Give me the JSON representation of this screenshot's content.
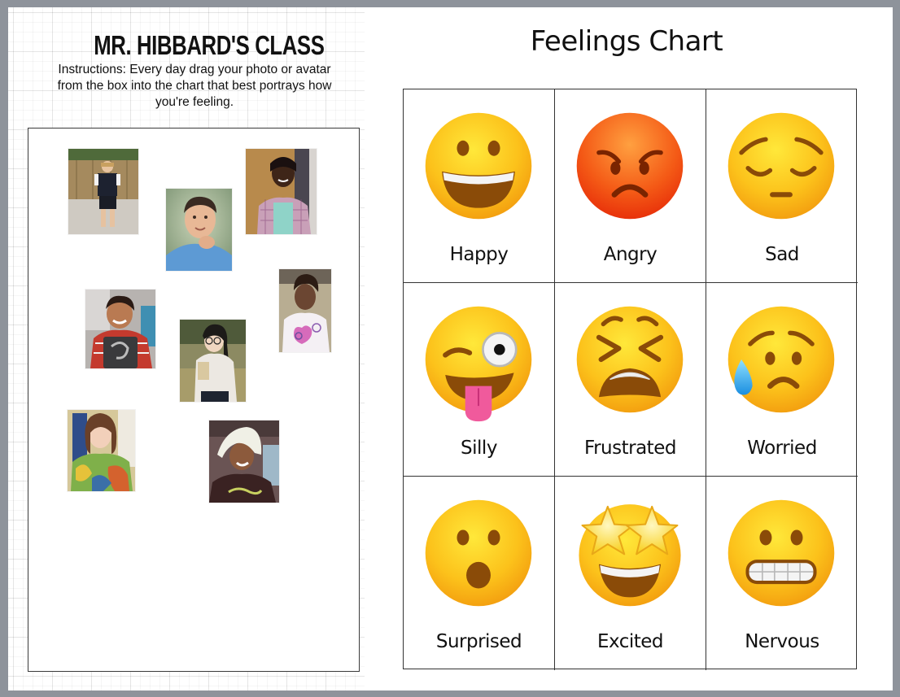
{
  "left_panel": {
    "class_title": "MR. HIBBARD'S CLASS",
    "instructions": "Instructions: Every day drag your photo or avatar from the box into the chart that best portrays how you're feeling.",
    "photo_box": {
      "photos": [
        {
          "name": "student-photo-1",
          "description": "boy in school uniform in front of wooden fence"
        },
        {
          "name": "student-photo-2",
          "description": "smiling boy with hand on chin, blue shirt"
        },
        {
          "name": "student-photo-3",
          "description": "smiling girl in plaid shirt"
        },
        {
          "name": "student-photo-4",
          "description": "smiling boy holding chalkboard"
        },
        {
          "name": "student-photo-5",
          "description": "girl with glasses holding book in field"
        },
        {
          "name": "student-photo-6",
          "description": "girl in pink heart t-shirt"
        },
        {
          "name": "student-photo-7",
          "description": "girl in colorful floral dress"
        },
        {
          "name": "student-photo-8",
          "description": "boy with book on head"
        }
      ]
    }
  },
  "chart": {
    "title": "Feelings Chart",
    "cells": [
      {
        "label": "Happy",
        "icon": "grinning-face-icon"
      },
      {
        "label": "Angry",
        "icon": "angry-face-icon"
      },
      {
        "label": "Sad",
        "icon": "pensive-face-icon"
      },
      {
        "label": "Silly",
        "icon": "winking-tongue-face-icon"
      },
      {
        "label": "Frustrated",
        "icon": "tired-face-icon"
      },
      {
        "label": "Worried",
        "icon": "sweat-sad-face-icon"
      },
      {
        "label": "Surprised",
        "icon": "surprised-face-icon"
      },
      {
        "label": "Excited",
        "icon": "star-struck-face-icon"
      },
      {
        "label": "Nervous",
        "icon": "grimacing-face-icon"
      }
    ]
  },
  "colors": {
    "frame": "#8e939b",
    "emoji_yellow": "#fcc21b",
    "emoji_angry": "#f45a16",
    "feature_brown": "#8a4b08"
  }
}
